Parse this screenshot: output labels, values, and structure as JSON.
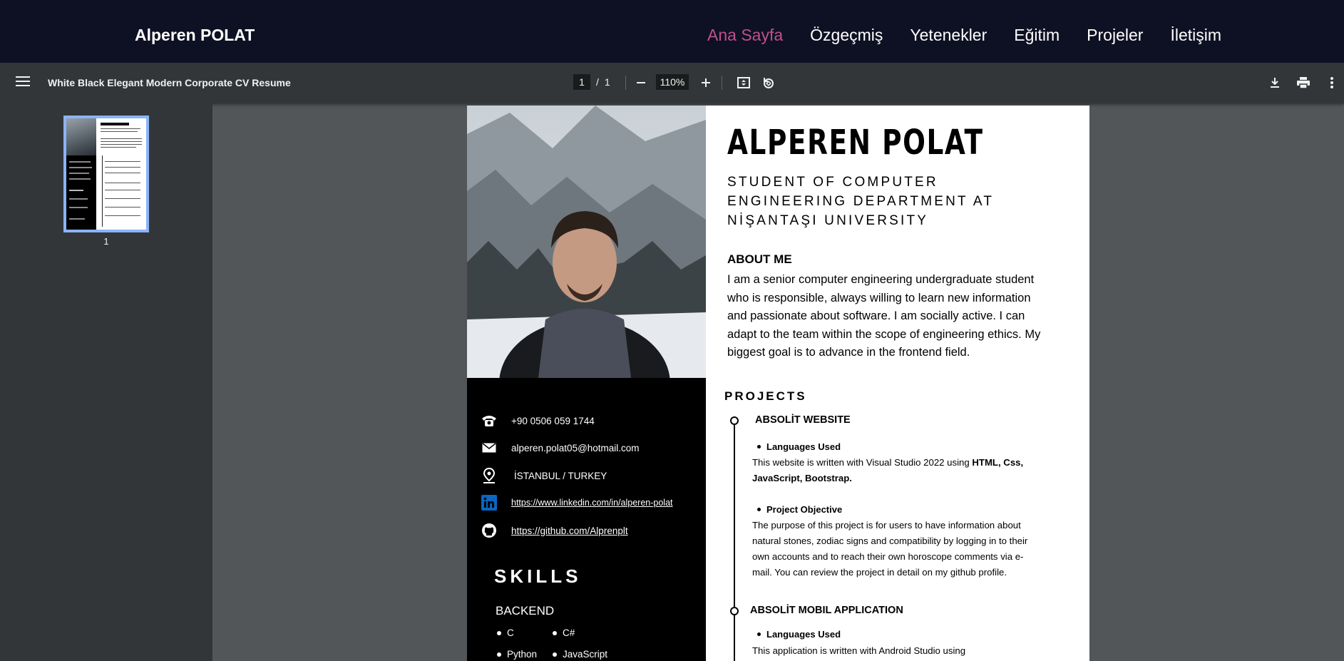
{
  "navbar": {
    "brand": "Alperen POLAT",
    "links": [
      "Ana Sayfa",
      "Özgeçmiş",
      "Yetenekler",
      "Eğitim",
      "Projeler",
      "İletişim"
    ]
  },
  "toolbar": {
    "title": "White Black Elegant Modern Corporate CV Resume",
    "current_page": "1",
    "page_separator": "/",
    "total_pages": "1",
    "zoom": "110%"
  },
  "sidebar": {
    "thumbnail_label": "1"
  },
  "cv": {
    "name": "ALPEREN POLAT",
    "subtitle": "STUDENT OF COMPUTER ENGINEERING DEPARTMENT AT NİŞANTAŞI UNIVERSITY",
    "about_title": "ABOUT ME",
    "about_text": "I am a senior computer engineering undergraduate student who is responsible, always willing to learn new information and passionate about software. I am socially active. I can adapt to the team within the scope of engineering ethics. My biggest goal is to advance in the frontend field.",
    "contact": {
      "phone": "+90 0506 059 1744",
      "email": "alperen.polat05@hotmail.com",
      "location": "İSTANBUL / TURKEY",
      "linkedin": "https://www.linkedin.com/in/alperen-polat",
      "github": "https://github.com/Alprenplt"
    },
    "skills_title": "SKILLS",
    "backend_title": "BACKEND",
    "backend_skills": [
      "C",
      "C#",
      "Python",
      "JavaScript"
    ],
    "projects_title": "PROJECTS",
    "projects": [
      {
        "name": "ABSOLİT WEBSITE",
        "languages_label": "Languages Used",
        "languages_text_plain": "This website is written with Visual Studio 2022 using ",
        "languages_text_bold": "HTML, Css, JavaScript, Bootstrap.",
        "objective_label": "Project Objective",
        "objective_text": "The purpose of this project is for users to have information about natural stones, zodiac signs and compatibility by logging in to their own accounts and to reach their own horoscope comments via e-mail. You can review the project in detail on my github profile."
      },
      {
        "name": "ABSOLİT MOBIL APPLICATION",
        "languages_label": "Languages Used",
        "languages_text_plain": "This application is written with Android Studio using"
      }
    ]
  },
  "colors": {
    "navbar_bg": "#0e1123",
    "active_link": "#c0508c",
    "toolbar_bg": "#323639",
    "viewer_bg": "#525659",
    "thumbnail_border": "#8ab4f8"
  }
}
